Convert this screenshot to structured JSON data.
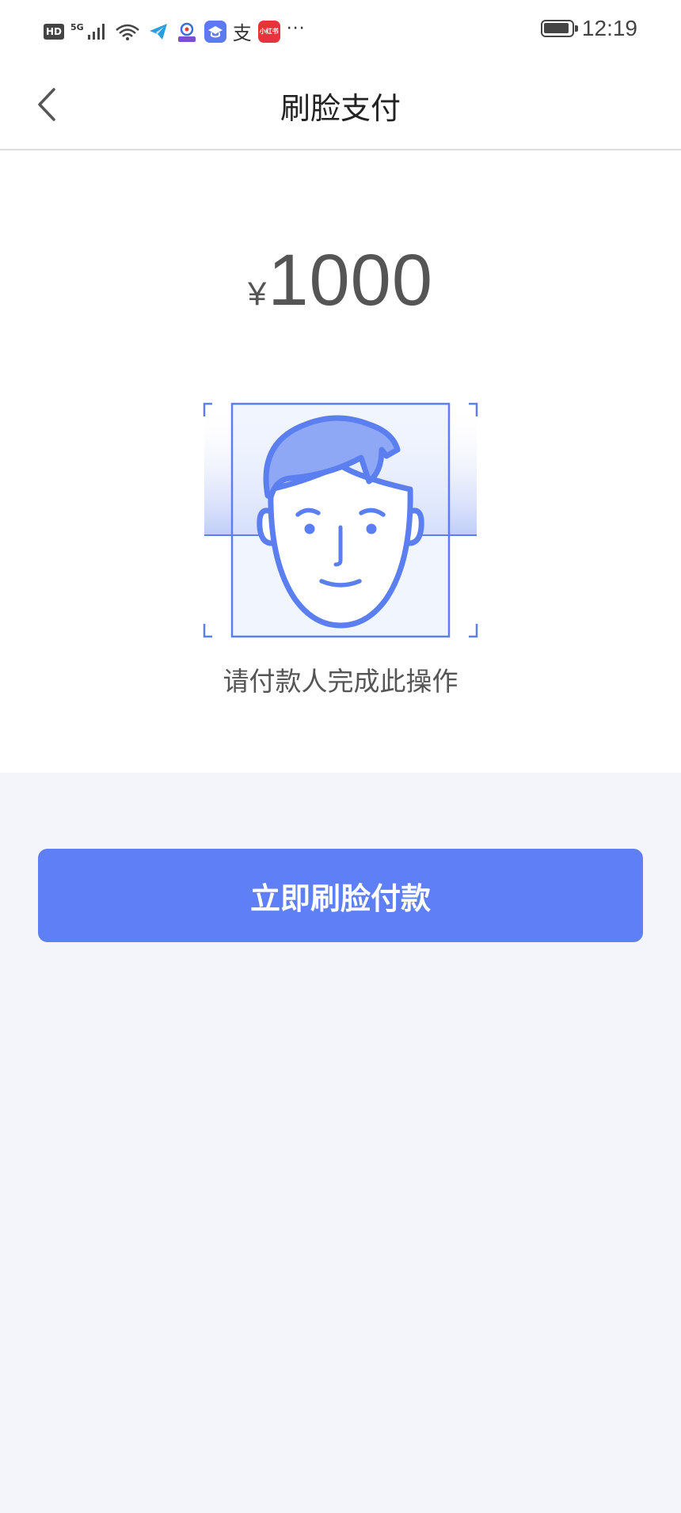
{
  "status_bar": {
    "hd_label": "HD",
    "network_label": "5G",
    "red_app_label": "小红书",
    "pay_glyph": "支",
    "more": "···",
    "time": "12:19"
  },
  "nav": {
    "title": "刷脸支付",
    "back_icon": "chevron-left-icon"
  },
  "payment": {
    "currency_symbol": "¥",
    "amount": "1000",
    "hint": "请付款人完成此操作"
  },
  "actions": {
    "pay_button_label": "立即刷脸付款"
  },
  "colors": {
    "accent": "#5e7ff5",
    "face_stroke": "#5b7ff0",
    "face_fill": "#e6ecfd",
    "page_bg": "#f4f5fa"
  }
}
